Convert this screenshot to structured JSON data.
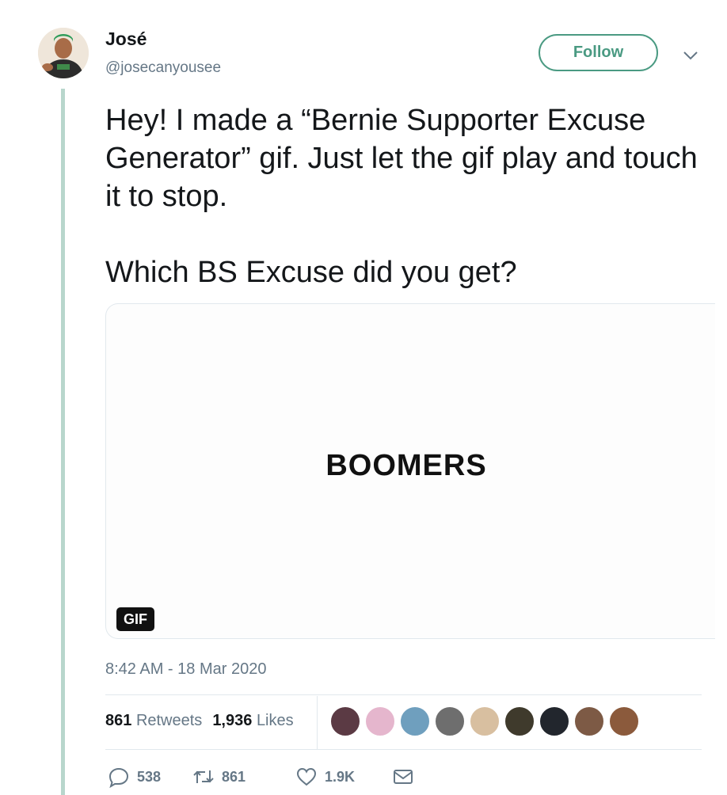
{
  "user": {
    "display_name": "José",
    "handle": "@josecanyousee"
  },
  "follow_label": "Follow",
  "tweet": {
    "paragraphs": [
      "Hey! I made a “Bernie Supporter Excuse Generator” gif. Just let the gif play and touch it to stop.",
      "Which BS Excuse did you get?"
    ]
  },
  "media": {
    "gif_text": "BOOMERS",
    "badge": "GIF"
  },
  "timestamp": "8:42 AM - 18 Mar 2020",
  "stats": {
    "retweets_count": "861",
    "retweets_label": "Retweets",
    "likes_count": "1,936",
    "likes_label": "Likes"
  },
  "liker_avatars": [
    "avatar-1",
    "avatar-2",
    "avatar-3",
    "avatar-4",
    "avatar-5",
    "avatar-6",
    "avatar-7",
    "avatar-8",
    "avatar-9"
  ],
  "liker_avatar_colors": [
    "#5b3a44",
    "#e5b6cd",
    "#6f9fbe",
    "#6e6e6e",
    "#d8bfa0",
    "#3f3a2c",
    "#22262d",
    "#7d5a45",
    "#8b5a3c"
  ],
  "actions": {
    "reply_count": "538",
    "retweet_count": "861",
    "like_count": "1.9K"
  },
  "icons": [
    "reply-icon",
    "retweet-icon",
    "like-icon",
    "dm-icon",
    "chevron-down-icon"
  ],
  "colors": {
    "accent": "#4a9a82",
    "thread_line": "#b8d6cc",
    "secondary_text": "#657786",
    "divider": "#e1e8ed"
  }
}
